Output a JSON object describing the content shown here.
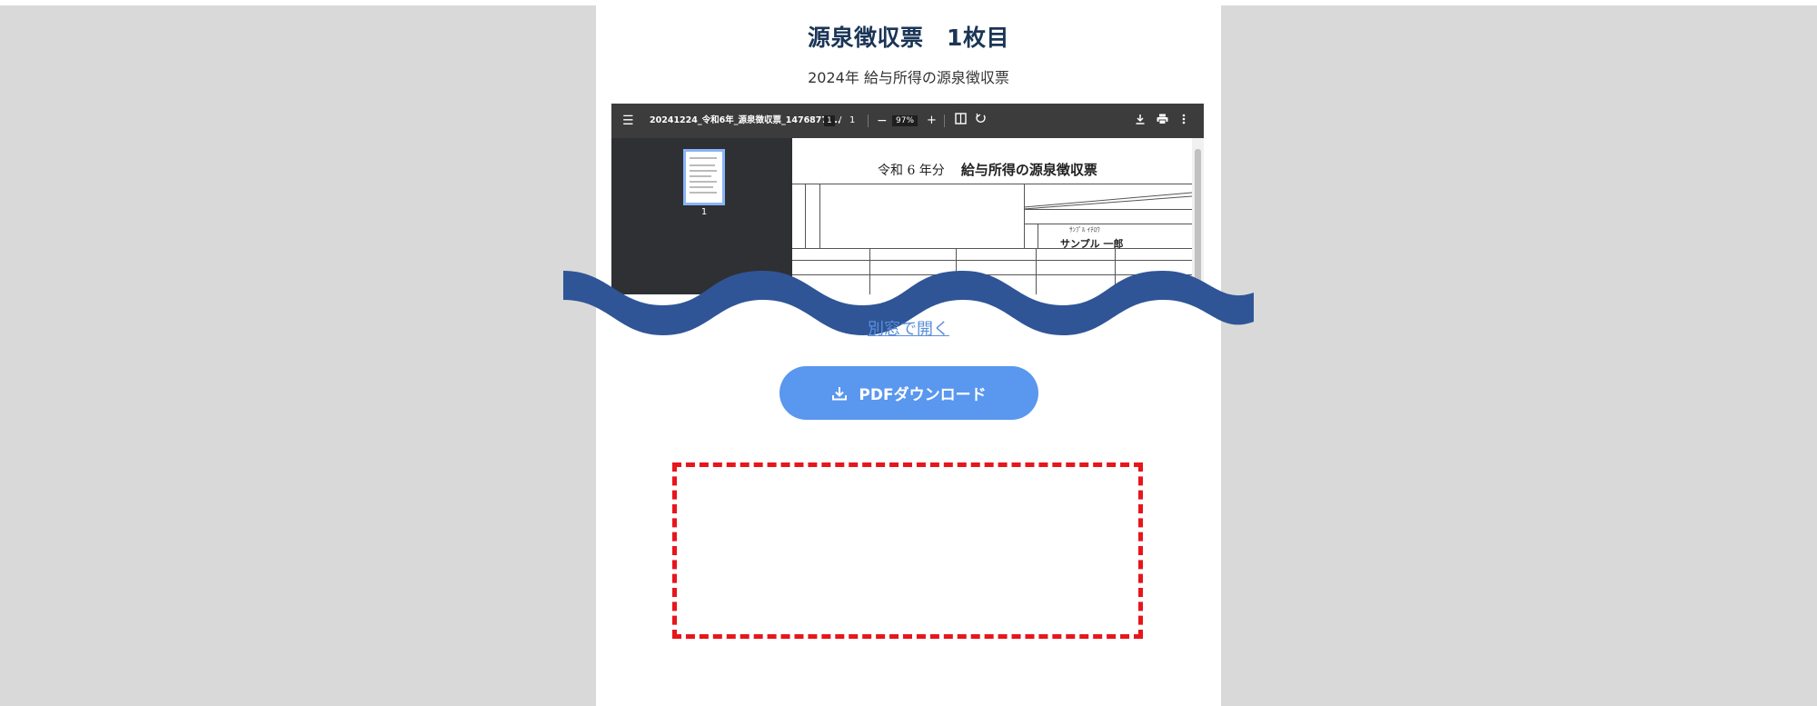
{
  "page": {
    "title": "源泉徴収票　1枚目",
    "subtitle": "2024年 給与所得の源泉徴収票"
  },
  "viewer": {
    "menu_icon": "☰",
    "filename": "20241224_令和6年_源泉徴収票_1476877....",
    "page_current": "1",
    "page_separator": "/",
    "page_total": "1",
    "zoom_out": "−",
    "zoom": "97%",
    "zoom_in": "+",
    "thumbnail_page": "1",
    "document": {
      "title_era": "令和 6 年分",
      "title_main": "給与所得の源泉徴収票",
      "recipient_kana": "ｻﾝﾌﾟﾙ ｲﾁﾛｳ",
      "recipient_name": "サンプル 一郎"
    }
  },
  "links": {
    "open_new_window": "別窓で開く"
  },
  "buttons": {
    "pdf_download": "PDFダウンロード"
  },
  "colors": {
    "title": "#1a3556",
    "wave": "#2f5597",
    "button": "#5a97ee",
    "link": "#5b8fd8",
    "dashed_border": "#e8151b",
    "side_background": "#d9d9d9"
  }
}
